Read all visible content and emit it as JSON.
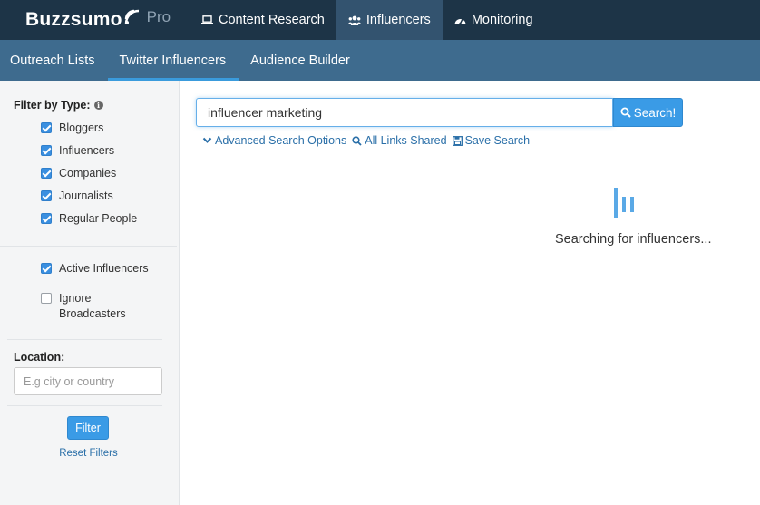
{
  "brand": {
    "name": "Buzzsumo",
    "suffix": "Pro"
  },
  "topnav": {
    "items": [
      {
        "label": "Content Research",
        "icon": "laptop-icon",
        "active": false
      },
      {
        "label": "Influencers",
        "icon": "users-icon",
        "active": true
      },
      {
        "label": "Monitoring",
        "icon": "dashboard-icon",
        "active": false
      }
    ]
  },
  "subnav": {
    "items": [
      {
        "label": "Outreach Lists",
        "active": false
      },
      {
        "label": "Twitter Influencers",
        "active": true
      },
      {
        "label": "Audience Builder",
        "active": false
      }
    ]
  },
  "sidebar": {
    "filter_title": "Filter by Type:",
    "types": [
      {
        "label": "Bloggers",
        "checked": true
      },
      {
        "label": "Influencers",
        "checked": true
      },
      {
        "label": "Companies",
        "checked": true
      },
      {
        "label": "Journalists",
        "checked": true
      },
      {
        "label": "Regular People",
        "checked": true
      }
    ],
    "options": [
      {
        "label": "Active Influencers",
        "checked": true
      },
      {
        "label": "Ignore Broadcasters",
        "checked": false
      }
    ],
    "location_title": "Location:",
    "location_placeholder": "E.g city or country",
    "filter_button": "Filter",
    "reset_link": "Reset Filters"
  },
  "search": {
    "value": "influencer marketing",
    "button_label": "Search!",
    "links": {
      "advanced": "Advanced Search Options",
      "all_links": "All Links Shared",
      "save": "Save Search"
    }
  },
  "status": {
    "text": "Searching for influencers..."
  },
  "colors": {
    "topbar": "#1d3447",
    "subbar": "#3e6b8e",
    "accent": "#3a9be6",
    "link": "#2a6fa8",
    "loader": "#5aa9e6"
  }
}
